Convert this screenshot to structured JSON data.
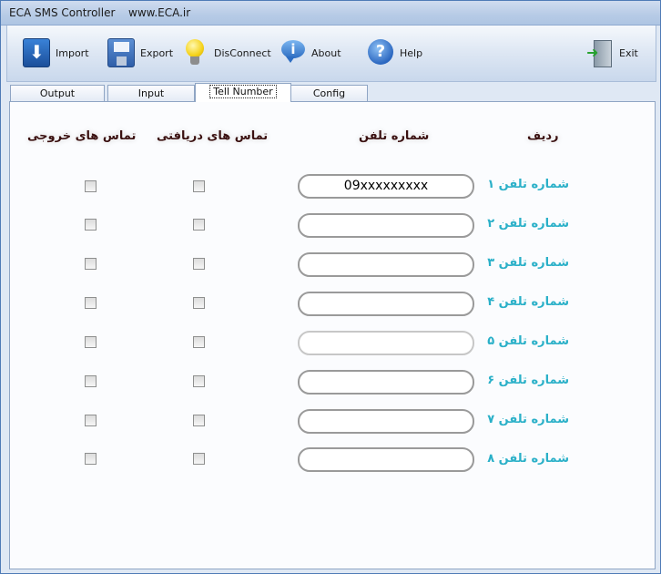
{
  "window": {
    "title": "ECA SMS Controller",
    "url": "www.ECA.ir"
  },
  "toolbar": {
    "import": {
      "label": "Import",
      "icon": "import-icon"
    },
    "export": {
      "label": "Export",
      "icon": "floppy-disk-icon"
    },
    "disconnect": {
      "label": "DisConnect",
      "icon": "lightbulb-icon"
    },
    "about": {
      "label": "About",
      "icon": "info-bubble-icon"
    },
    "help": {
      "label": "Help",
      "icon": "help-icon"
    },
    "exit": {
      "label": "Exit",
      "icon": "exit-door-icon"
    }
  },
  "tabs": [
    {
      "label": "Output",
      "active": false
    },
    {
      "label": "Input",
      "active": false
    },
    {
      "label": "Tell Number",
      "active": true
    },
    {
      "label": "Config",
      "active": false
    }
  ],
  "table": {
    "headers": {
      "row": "ردیف",
      "phone": "شماره تلفن",
      "incoming": "تماس های دریافتی",
      "outgoing": "تماس های خروجی"
    },
    "rows": [
      {
        "label": "شماره تلفن ۱",
        "value": "09xxxxxxxxx",
        "incoming": false,
        "outgoing": false
      },
      {
        "label": "شماره تلفن ۲",
        "value": "",
        "incoming": false,
        "outgoing": false
      },
      {
        "label": "شماره تلفن ۳",
        "value": "",
        "incoming": false,
        "outgoing": false
      },
      {
        "label": "شماره تلفن ۴",
        "value": "",
        "incoming": false,
        "outgoing": false
      },
      {
        "label": "شماره تلفن ۵",
        "value": "",
        "incoming": false,
        "outgoing": false
      },
      {
        "label": "شماره تلفن ۶",
        "value": "",
        "incoming": false,
        "outgoing": false
      },
      {
        "label": "شماره تلفن ۷",
        "value": "",
        "incoming": false,
        "outgoing": false
      },
      {
        "label": "شماره تلفن ۸",
        "value": "",
        "incoming": false,
        "outgoing": false
      }
    ]
  },
  "colors": {
    "row_label": "#2ab0c8",
    "header_text": "#3a1010",
    "window_bg": "#dfe8f4"
  }
}
